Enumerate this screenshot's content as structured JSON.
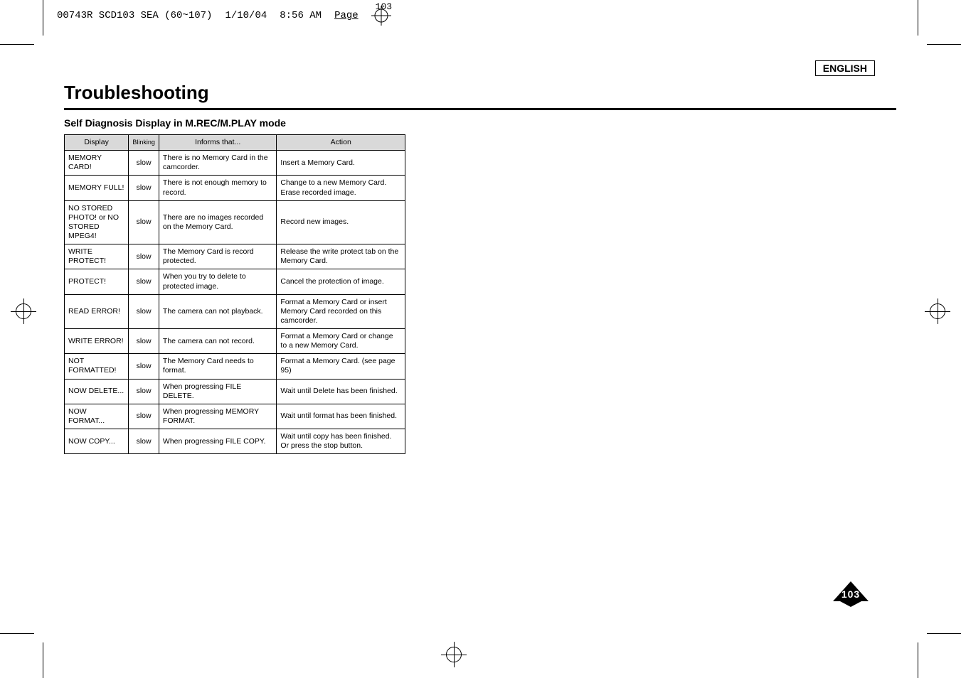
{
  "print_header": {
    "filename": "00743R SCD103 SEA (60~107)",
    "date": "1/10/04",
    "time": "8:56 AM",
    "page_label": "Page",
    "page_partial": "103"
  },
  "lang": "ENGLISH",
  "title": "Troubleshooting",
  "subhead": "Self Diagnosis Display in M.REC/M.PLAY mode",
  "columns": {
    "display": "Display",
    "blinking": "Blinking",
    "informs": "Informs that...",
    "action": "Action"
  },
  "rows": [
    {
      "display": "MEMORY CARD!",
      "blinking": "slow",
      "informs": "There is no Memory Card in the camcorder.",
      "action": "Insert a Memory Card."
    },
    {
      "display": "MEMORY FULL!",
      "blinking": "slow",
      "informs": "There is not enough memory to record.",
      "action": "Change to a new Memory Card. Erase recorded image."
    },
    {
      "display": "NO STORED PHOTO! or NO STORED MPEG4!",
      "blinking": "slow",
      "informs": "There are no images recorded on the Memory Card.",
      "action": "Record new images."
    },
    {
      "display": "WRITE PROTECT!",
      "blinking": "slow",
      "informs": "The Memory Card is record protected.",
      "action": "Release the write protect tab on the Memory Card."
    },
    {
      "display": "PROTECT!",
      "blinking": "slow",
      "informs": "When you try to delete to protected image.",
      "action": "Cancel the protection of image."
    },
    {
      "display": "READ ERROR!",
      "blinking": "slow",
      "informs": "The camera can not playback.",
      "action": "Format a Memory Card or insert Memory Card recorded on this camcorder."
    },
    {
      "display": "WRITE ERROR!",
      "blinking": "slow",
      "informs": "The camera can not record.",
      "action": "Format a Memory Card or change to a new Memory Card."
    },
    {
      "display": "NOT FORMATTED!",
      "blinking": "slow",
      "informs": "The Memory Card needs to format.",
      "action": "Format a Memory Card. (see page 95)"
    },
    {
      "display": "NOW DELETE...",
      "blinking": "slow",
      "informs": "When progressing FILE DELETE.",
      "action": "Wait until Delete has been finished."
    },
    {
      "display": "NOW FORMAT...",
      "blinking": "slow",
      "informs": "When progressing MEMORY FORMAT.",
      "action": "Wait until format has been finished."
    },
    {
      "display": "NOW COPY...",
      "blinking": "slow",
      "informs": "When progressing FILE COPY.",
      "action": "Wait until copy has been finished.\nOr press the stop button."
    }
  ],
  "page_number": "103"
}
